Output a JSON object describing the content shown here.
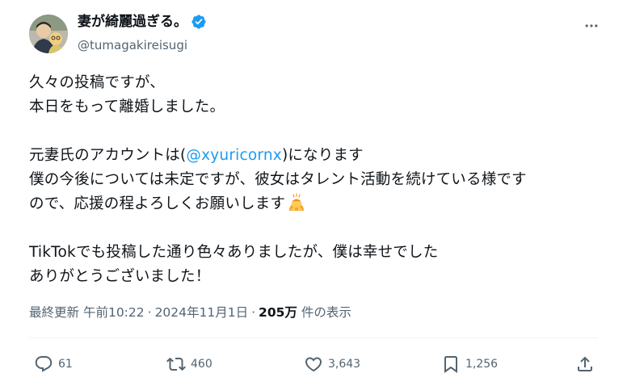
{
  "user": {
    "display_name": "妻が綺麗過ぎる。",
    "handle": "@tumagakireisugi",
    "verified_color": "#1d9bf0"
  },
  "tweet": {
    "line1": "久々の投稿ですが、",
    "line2": "本日をもって離婚しました。",
    "line3_pre": "元妻氏のアカウントは(",
    "line3_mention": "@xyuricornx",
    "line3_post": ")になります",
    "line4": "僕の今後については未定ですが、彼女はタレント活動を続けている様です",
    "line5": "ので、応援の程よろしくお願いします",
    "line6": "TikTokでも投稿した通り色々ありましたが、僕は幸せでした",
    "line7": "ありがとうございました！",
    "emoji_name": "person-bowing-emoji"
  },
  "meta": {
    "updated_label": "最終更新",
    "time": "午前10:22",
    "date": "2024年11月1日",
    "views_count": "205万",
    "views_label": "件の表示"
  },
  "actions": {
    "replies": "61",
    "reposts": "460",
    "likes": "3,643",
    "bookmarks": "1,256"
  },
  "colors": {
    "link": "#1d9bf0",
    "secondary_text": "#536471",
    "primary_text": "#0f1419"
  }
}
